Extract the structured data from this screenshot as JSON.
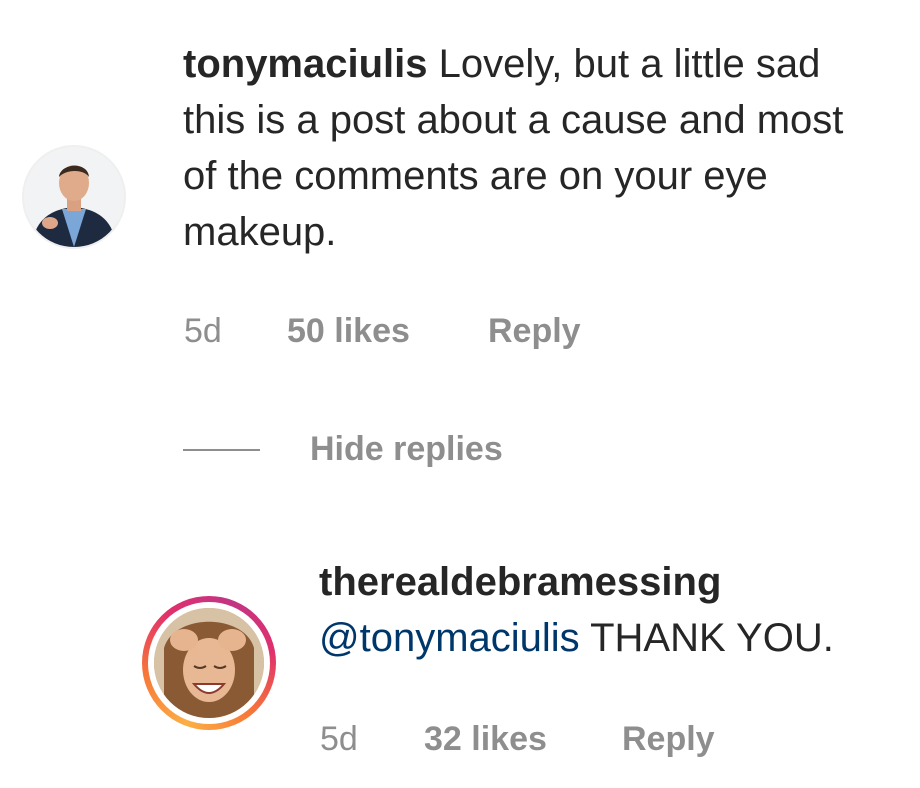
{
  "comments": [
    {
      "username": "tonymaciulis",
      "text": " Lovely, but a little sad this is a post about a cause and most of the comments are on your eye makeup.",
      "time": "5d",
      "likes": "50 likes",
      "reply_label": "Reply",
      "avatar_icon": "profile-photo-man-suit"
    }
  ],
  "thread": {
    "toggle_label": "Hide replies"
  },
  "replies": [
    {
      "username": "therealdebramessing",
      "mention": "@tonymaciulis",
      "text": " THANK YOU.",
      "time": "5d",
      "likes": "32 likes",
      "reply_label": "Reply",
      "avatar_icon": "profile-photo-woman-laughing",
      "story_ring": true
    }
  ],
  "colors": {
    "text": "#262626",
    "muted": "#8e8e8e",
    "mention": "#00376b",
    "story_ring": [
      "#fcaf45",
      "#f77737",
      "#e1306c",
      "#c13584"
    ]
  }
}
